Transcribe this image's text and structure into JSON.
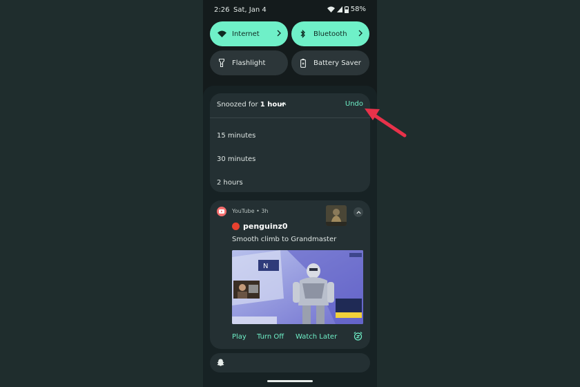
{
  "status_bar": {
    "time": "2:26",
    "date": "Sat, Jan 4",
    "battery": "58%"
  },
  "quick_settings": [
    {
      "label": "Internet",
      "icon": "wifi-icon",
      "state": "on",
      "has_chevron": true
    },
    {
      "label": "Bluetooth",
      "icon": "bluetooth-icon",
      "state": "on",
      "has_chevron": true
    },
    {
      "label": "Flashlight",
      "icon": "flashlight-icon",
      "state": "off",
      "has_chevron": false
    },
    {
      "label": "Battery Saver",
      "icon": "battery-saver-icon",
      "state": "off",
      "has_chevron": false
    }
  ],
  "snooze": {
    "prefix": "Snoozed for ",
    "duration": "1 hour",
    "undo_label": "Undo",
    "options": [
      "15 minutes",
      "30 minutes",
      "2 hours"
    ]
  },
  "youtube_notification": {
    "app": "YouTube • 3h",
    "channel": "penguinz0",
    "description": "Smooth climb to Grandmaster",
    "actions": [
      "Play",
      "Turn Off",
      "Watch Later"
    ]
  },
  "colors": {
    "accent": "#6ff0c8",
    "background": "#1f2d2d",
    "arrow": "#e8324a",
    "live": "#e8412f"
  }
}
